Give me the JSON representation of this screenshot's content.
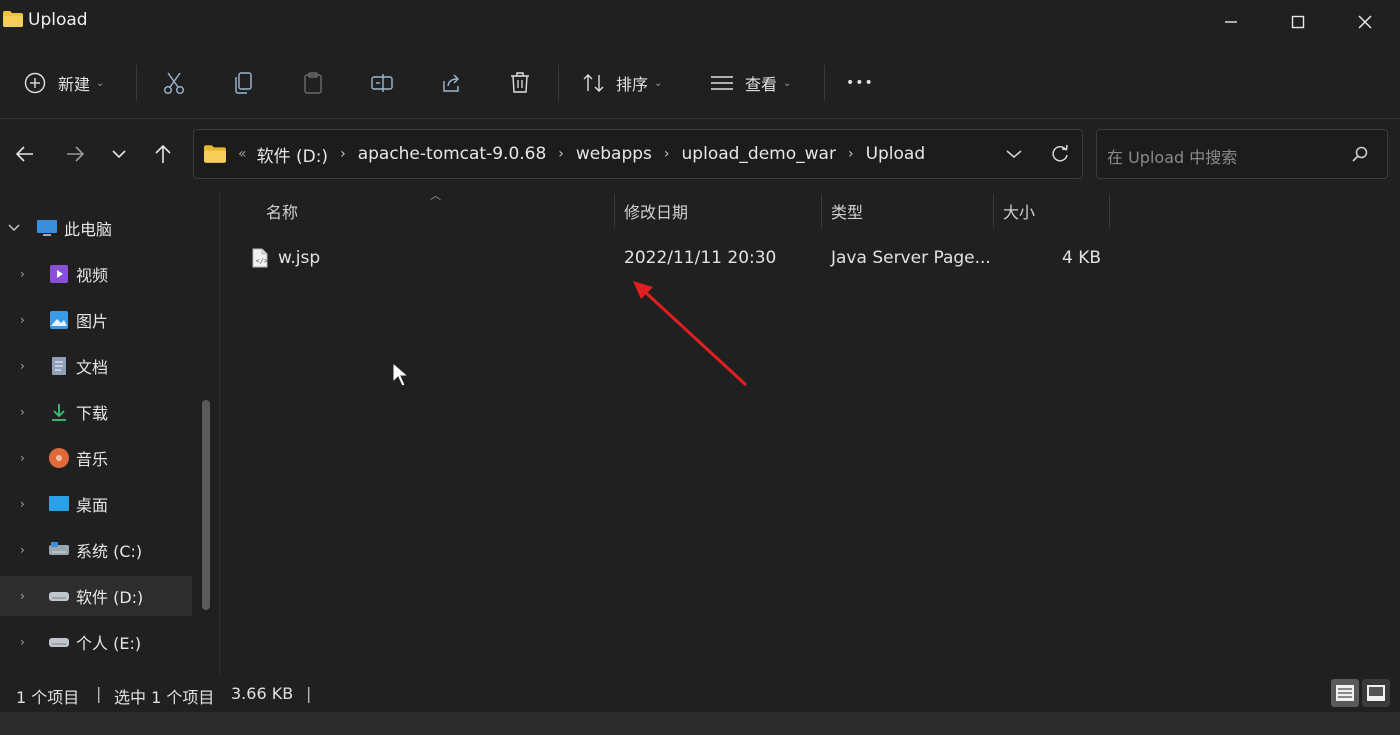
{
  "window": {
    "title": "Upload",
    "controls": [
      "minimize",
      "maximize",
      "close"
    ]
  },
  "toolbar": {
    "new_label": "新建",
    "sort_label": "排序",
    "view_label": "查看",
    "more_label": "•••"
  },
  "address": {
    "overflow": "«",
    "crumbs": [
      "软件 (D:)",
      "apache-tomcat-9.0.68",
      "webapps",
      "upload_demo_war",
      "Upload"
    ]
  },
  "search": {
    "placeholder": "在 Upload 中搜索"
  },
  "sidebar": {
    "items": [
      {
        "label": "此电脑",
        "icon": "computer-icon",
        "expanded": true
      },
      {
        "label": "视频",
        "icon": "video-icon"
      },
      {
        "label": "图片",
        "icon": "pictures-icon"
      },
      {
        "label": "文档",
        "icon": "documents-icon"
      },
      {
        "label": "下载",
        "icon": "download-icon"
      },
      {
        "label": "音乐",
        "icon": "music-icon"
      },
      {
        "label": "桌面",
        "icon": "desktop-icon"
      },
      {
        "label": "系统 (C:)",
        "icon": "system-drive-icon"
      },
      {
        "label": "软件 (D:)",
        "icon": "drive-icon",
        "selected": true
      },
      {
        "label": "个人 (E:)",
        "icon": "drive-icon"
      }
    ]
  },
  "columns": {
    "name": "名称",
    "date": "修改日期",
    "type": "类型",
    "size": "大小"
  },
  "files": [
    {
      "name": "w.jsp",
      "date": "2022/11/11 20:30",
      "type": "Java Server Page...",
      "size": "4 KB",
      "icon": "jsp-file-icon"
    }
  ],
  "status": {
    "count": "1 个项目",
    "selected": "选中 1 个项目",
    "size": "3.66 KB"
  },
  "colors": {
    "background": "#202020",
    "annotation_arrow": "#e02020",
    "folder": "#f0c040"
  }
}
